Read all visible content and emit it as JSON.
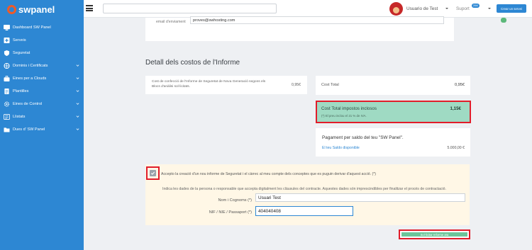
{
  "brand": {
    "name": "swpanel"
  },
  "sidebar": {
    "items": [
      {
        "label": "Dashboard SW Panel",
        "icon": "dashboard-icon",
        "has_children": false
      },
      {
        "label": "Serveis",
        "icon": "plus-box-icon",
        "has_children": false
      },
      {
        "label": "Seguretat",
        "icon": "shield-icon",
        "has_children": false
      },
      {
        "label": "Dominis i Certificats",
        "icon": "globe-icon",
        "has_children": true
      },
      {
        "label": "Eines per a Clouds",
        "icon": "briefcase-icon",
        "has_children": true
      },
      {
        "label": "Plantilles",
        "icon": "document-icon",
        "has_children": true
      },
      {
        "label": "Eines de Control",
        "icon": "gear-icon",
        "has_children": true
      },
      {
        "label": "Llistats",
        "icon": "list-icon",
        "has_children": true
      },
      {
        "label": "Dues d' SW Panel",
        "icon": "folder-icon",
        "has_children": true
      }
    ]
  },
  "topbar": {
    "search_placeholder": "",
    "user_name": "Usuario de Test",
    "support_label": "Suport",
    "support_badge": "266",
    "new_service_label": "Crear un servei"
  },
  "email": {
    "label": "email d'enviament",
    "value": "proves@swhosting.com"
  },
  "section_title": "Detall dels costos de l'Informe",
  "description": {
    "text": "Cost de confecció de l'Informe de Seguretat de Nova Generació segons els Blocs d'anàlisi sol·licitats.",
    "price": "0,95€"
  },
  "total": {
    "label": "Cost Total",
    "price": "0,95€"
  },
  "tax_total": {
    "label": "Cost Total impostos inclosos",
    "note": "(*) El preu inclou el 21 % de IVA.",
    "price": "1,15€"
  },
  "saldo": {
    "title": "Pagament per saldo del teu \"SW Panel\".",
    "label": "El teu Saldo disponible",
    "value": "5.000,00 €"
  },
  "accept": {
    "text": "Accepto la creació d'un nou informe de Seguretat i el càrrec al meu compte dels conceptes que es puguin derivar d'aquest acció. (*)",
    "info": "Indica les dades de la persona o responsable que accepta digitalment les clàusules del contracte. Aquestes dades són imprescindibles per finalitzar el procés de contractació.",
    "name_label": "Nom i Cognoms (*)",
    "name_value": "Usuari Test",
    "nif_label": "NIF / NIE / Passaport (*)",
    "nif_value": "404040408"
  },
  "submit_label": "Sol·licitar Informe ara",
  "colors": {
    "sidebar": "#2d87d3",
    "highlight": "#9fdac3",
    "annotation_red": "#e11d2a",
    "accept_bg": "#fff7e6"
  }
}
